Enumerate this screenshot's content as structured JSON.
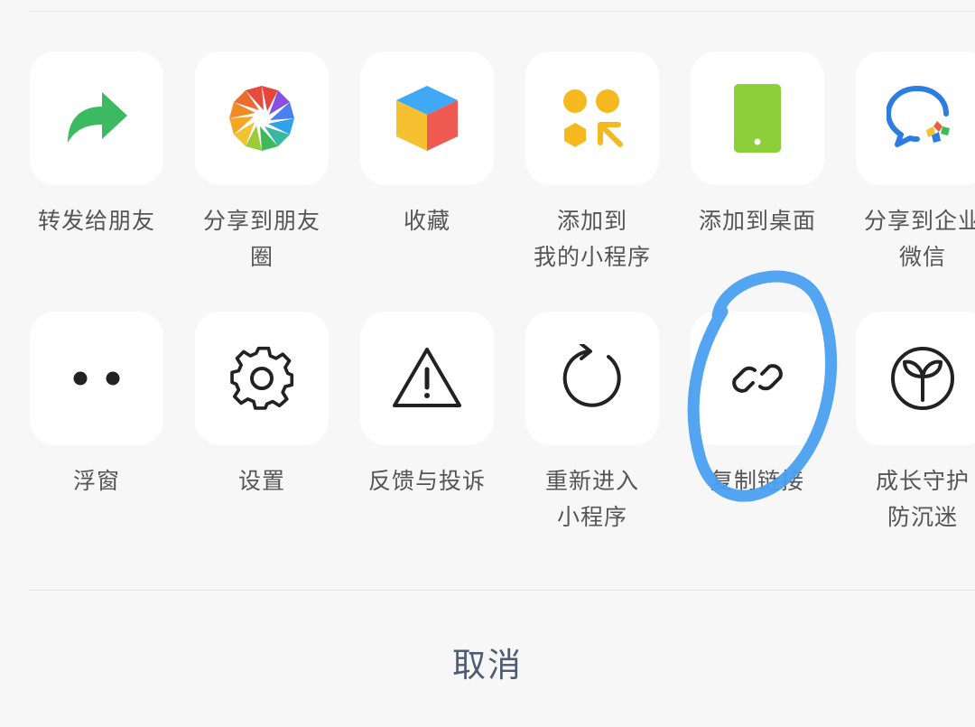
{
  "row1": [
    {
      "icon": "forward-icon",
      "lines": [
        "转发给朋友"
      ]
    },
    {
      "icon": "moments-icon",
      "lines": [
        "分享到朋友",
        "圈"
      ]
    },
    {
      "icon": "favorites-cube-icon",
      "lines": [
        "收藏"
      ]
    },
    {
      "icon": "add-miniprogram-icon",
      "lines": [
        "添加到",
        "我的小程序"
      ]
    },
    {
      "icon": "desktop-phone-icon",
      "lines": [
        "添加到桌面"
      ]
    },
    {
      "icon": "wecom-icon",
      "lines": [
        "分享到企业",
        "微信"
      ]
    }
  ],
  "row2": [
    {
      "icon": "float-window-icon",
      "lines": [
        "浮窗"
      ]
    },
    {
      "icon": "gear-icon",
      "lines": [
        "设置"
      ]
    },
    {
      "icon": "warning-icon",
      "lines": [
        "反馈与投诉"
      ]
    },
    {
      "icon": "refresh-icon",
      "lines": [
        "重新进入",
        "小程序"
      ]
    },
    {
      "icon": "link-icon",
      "lines": [
        "复制链接"
      ]
    },
    {
      "icon": "sprout-icon",
      "lines": [
        "成长守护",
        "防沉迷"
      ]
    }
  ],
  "cancel_label": "取消",
  "colors": {
    "background": "#f7f7f7",
    "tile": "#ffffff",
    "label": "#555555",
    "cancel": "#4b5d75",
    "annotation": "#4a9ff0"
  }
}
